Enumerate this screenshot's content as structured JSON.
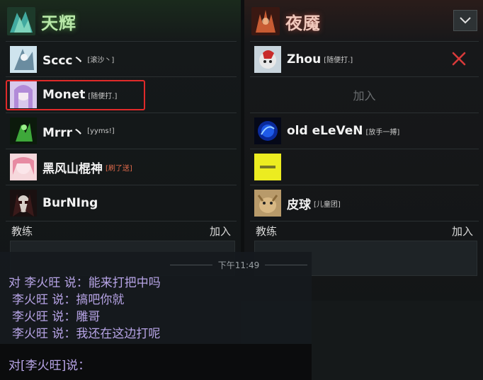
{
  "radiant": {
    "name": "天辉",
    "players": [
      {
        "name": "Sccc丶",
        "tag": "[滚沙丶]",
        "tag_color": "normal"
      },
      {
        "name": "Monet",
        "tag": "[随便打.]",
        "tag_color": "normal"
      },
      {
        "name": "Mrrr丶",
        "tag": "[yyms!]",
        "tag_color": "normal"
      },
      {
        "name": "黑风山棍神",
        "tag": "[刷了送]",
        "tag_color": "red"
      },
      {
        "name": "BurNIng",
        "tag": "",
        "tag_color": "normal"
      }
    ],
    "coach_label": "教练",
    "coach_join": "加入"
  },
  "dire": {
    "name": "夜魇",
    "players": [
      {
        "name": "Zhou",
        "tag": "[随便打.]"
      },
      {
        "empty_join": "加入"
      },
      {
        "name": "old eLeVeN",
        "tag": "[放手一搏]"
      },
      {
        "name": "",
        "tag": ""
      },
      {
        "name": "皮球",
        "tag": "[儿童团]"
      }
    ],
    "coach_label": "教练",
    "coach_join": "加入"
  },
  "chat": {
    "time": "下午11:49",
    "lines": [
      "对 李火旺 说：能来打把中吗",
      "李火旺 说：搞吧你就",
      "李火旺 说：雕哥",
      "李火旺 说：我还在这边打呢"
    ],
    "input_prefix": "对[李火旺]说："
  },
  "colors": {
    "highlight_box": "#e02a2a",
    "chat_text": "#b7a4e6",
    "kick_x": "#d83a3a"
  },
  "icons": [
    "radiant-team-icon",
    "dire-team-icon",
    "chevron-down-icon",
    "close-icon"
  ]
}
